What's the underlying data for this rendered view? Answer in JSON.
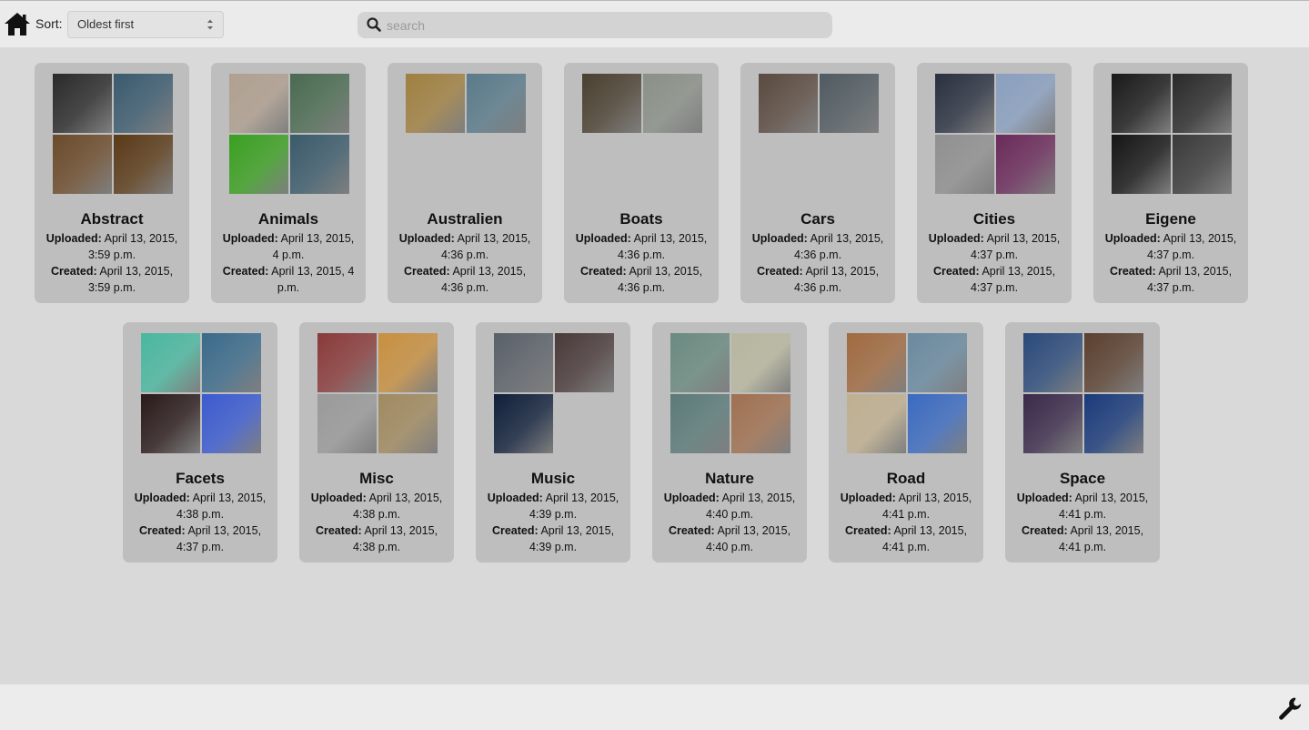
{
  "toolbar": {
    "home_icon": "home-icon",
    "sort_label": "Sort:",
    "sort_value": "Oldest first",
    "search_placeholder": "search"
  },
  "labels": {
    "uploaded": "Uploaded:",
    "created": "Created:"
  },
  "albums": [
    {
      "name": "Abstract",
      "uploaded": "April 13, 2015, 3:59 p.m.",
      "created": "April 13, 2015, 3:59 p.m.",
      "thumbs": [
        "#2a2a2a",
        "#3a5a6e",
        "#6b4a2a",
        "#5a3a18"
      ]
    },
    {
      "name": "Animals",
      "uploaded": "April 13, 2015, 4 p.m.",
      "created": "April 13, 2015, 4 p.m.",
      "thumbs": [
        "#b0a090",
        "#4a6a50",
        "#3aa020",
        "#3a5a6a"
      ]
    },
    {
      "name": "Australien",
      "uploaded": "April 13, 2015, 4:36 p.m.",
      "created": "April 13, 2015, 4:36 p.m.",
      "thumbs": [
        "#a08040",
        "#5a7a8a"
      ]
    },
    {
      "name": "Boats",
      "uploaded": "April 13, 2015, 4:36 p.m.",
      "created": "April 13, 2015, 4:36 p.m.",
      "thumbs": [
        "#4a4030",
        "#8a9088"
      ]
    },
    {
      "name": "Cars",
      "uploaded": "April 13, 2015, 4:36 p.m.",
      "created": "April 13, 2015, 4:36 p.m.",
      "thumbs": [
        "#5a4a40",
        "#505a60"
      ]
    },
    {
      "name": "Cities",
      "uploaded": "April 13, 2015, 4:37 p.m.",
      "created": "April 13, 2015, 4:37 p.m.",
      "thumbs": [
        "#2a3040",
        "#8aa0c0",
        "#909090",
        "#6a2a5a"
      ]
    },
    {
      "name": "Eigene",
      "uploaded": "April 13, 2015, 4:37 p.m.",
      "created": "April 13, 2015, 4:37 p.m.",
      "thumbs": [
        "#1a1a1a",
        "#2a2a2a",
        "#151515",
        "#3a3a3a"
      ]
    },
    {
      "name": "Facets",
      "uploaded": "April 13, 2015, 4:38 p.m.",
      "created": "April 13, 2015, 4:37 p.m.",
      "thumbs": [
        "#4ab8a0",
        "#3a6a8a",
        "#2a1a1a",
        "#3a5ad0"
      ]
    },
    {
      "name": "Misc",
      "uploaded": "April 13, 2015, 4:38 p.m.",
      "created": "April 13, 2015, 4:38 p.m.",
      "thumbs": [
        "#8a3a3a",
        "#c89040",
        "#9a9a9a",
        "#a08a60"
      ]
    },
    {
      "name": "Music",
      "uploaded": "April 13, 2015, 4:39 p.m.",
      "created": "April 13, 2015, 4:39 p.m.",
      "thumbs": [
        "#5a6068",
        "#4a3a3a",
        "#10203a"
      ]
    },
    {
      "name": "Nature",
      "uploaded": "April 13, 2015, 4:40 p.m.",
      "created": "April 13, 2015, 4:40 p.m.",
      "thumbs": [
        "#6a8a80",
        "#b8b8a0",
        "#5a7a78",
        "#a07050"
      ]
    },
    {
      "name": "Road",
      "uploaded": "April 13, 2015, 4:41 p.m.",
      "created": "April 13, 2015, 4:41 p.m.",
      "thumbs": [
        "#a06a40",
        "#6a8aa0",
        "#c0b090",
        "#3a6ac0"
      ]
    },
    {
      "name": "Space",
      "uploaded": "April 13, 2015, 4:41 p.m.",
      "created": "April 13, 2015, 4:41 p.m.",
      "thumbs": [
        "#2a4a7a",
        "#5a4030",
        "#3a2a4a",
        "#1a3a7a"
      ]
    }
  ],
  "footer": {
    "settings_icon": "wrench-icon"
  }
}
